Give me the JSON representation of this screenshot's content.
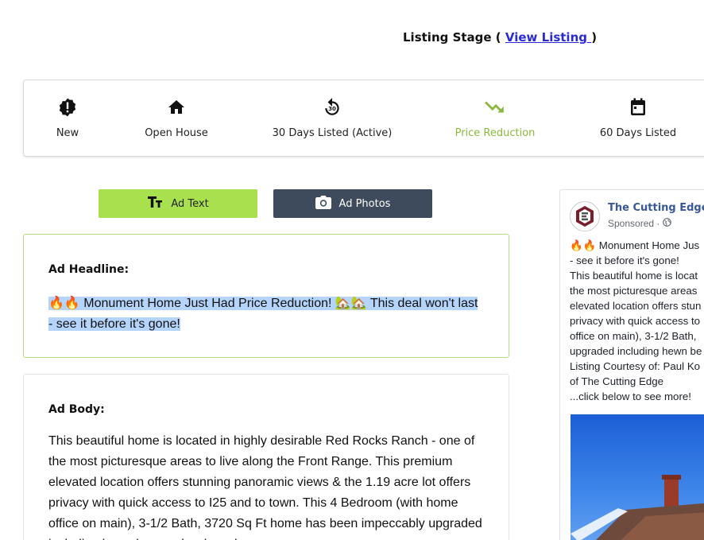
{
  "header": {
    "stage_label": "Listing Stage ( ",
    "view_listing": "View Listing ",
    "close_paren": ")"
  },
  "stages": [
    {
      "label": "New",
      "icon": "alert-badge-icon"
    },
    {
      "label": "Open House",
      "icon": "home-icon"
    },
    {
      "label": "30 Days Listed (Active)",
      "icon": "replay-30-icon"
    },
    {
      "label": "Price Reduction",
      "icon": "trending-down-icon",
      "active": true
    },
    {
      "label": "60 Days Listed",
      "icon": "calendar-icon"
    }
  ],
  "tabs": {
    "ad_text": "Ad Text",
    "ad_photos": "Ad Photos"
  },
  "headline": {
    "title": "Ad Headline:",
    "text": "🔥🔥 Monument Home Just Had Price Reduction! 🏡🏡 This deal won't last - see it before it's gone!"
  },
  "body": {
    "title": "Ad Body:",
    "text": "This beautiful home is located in highly desirable Red Rocks Ranch - one of the most picturesque areas to live along the Front Range.  This premium elevated location offers stunning panoramic views & the 1.19 acre lot offers privacy with quick access to I25 and to town. This 4 Bedroom (with home office on main), 3-1/2 Bath, 3720 Sq Ft home has been impeccably upgraded including hewn beams, hardwoods"
  },
  "preview": {
    "page_name": "The Cutting Edge,",
    "sponsored": "Sponsored ·",
    "lines": [
      "🔥🔥 Monument Home Jus",
      "- see it before it's gone!",
      "This beautiful home is locat",
      "the most picturesque areas",
      "elevated location offers stun",
      "privacy with quick access to",
      "office on main), 3-1/2 Bath,",
      "upgraded including hewn be",
      "Listing Courtesy of: Paul Ko",
      "of The Cutting Edge",
      "...click below to see more!"
    ]
  },
  "colors": {
    "active_stage": "#8bb83d",
    "ad_text_tab": "#a9e04d",
    "ad_photos_tab": "#3d4b5c",
    "link": "#2b2bd6"
  }
}
